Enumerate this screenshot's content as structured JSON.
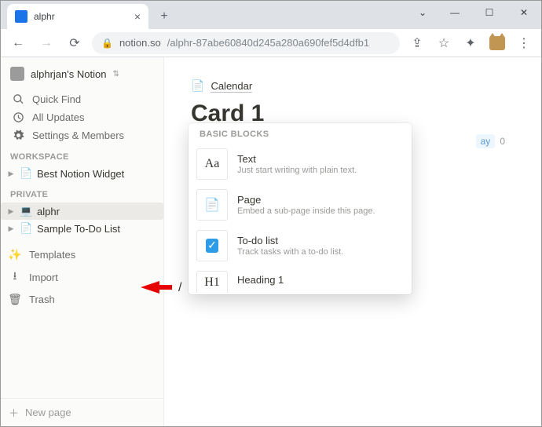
{
  "browser": {
    "tab_title": "alphr",
    "url_host": "notion.so",
    "url_path": "/alphr-87abe60840d245a280a690fef5d4dfb1"
  },
  "sidebar": {
    "workspace_name": "alphrjan's Notion",
    "nav": {
      "quick_find": "Quick Find",
      "all_updates": "All Updates",
      "settings": "Settings & Members"
    },
    "section_workspace": "WORKSPACE",
    "section_private": "PRIVATE",
    "pages_workspace": [
      {
        "icon": "📄",
        "label": "Best Notion Widget"
      }
    ],
    "pages_private": [
      {
        "icon": "💻",
        "label": "alphr",
        "selected": true
      },
      {
        "icon": "📄",
        "label": "Sample To-Do List"
      }
    ],
    "tools": {
      "templates": "Templates",
      "import": "Import",
      "trash": "Trash"
    },
    "new_page": "New page"
  },
  "main": {
    "breadcrumb_label": "Calendar",
    "title": "Card 1",
    "today_label": "ay",
    "today_count": "0",
    "slash_text": "/"
  },
  "menu": {
    "header": "BASIC BLOCKS",
    "items": [
      {
        "thumb": "Aa",
        "label": "Text",
        "desc": "Just start writing with plain text."
      },
      {
        "thumb": "📄",
        "label": "Page",
        "desc": "Embed a sub-page inside this page."
      },
      {
        "thumb": "✓",
        "label": "To-do list",
        "desc": "Track tasks with a to-do list."
      },
      {
        "thumb": "H1",
        "label": "Heading 1",
        "desc": ""
      }
    ]
  }
}
